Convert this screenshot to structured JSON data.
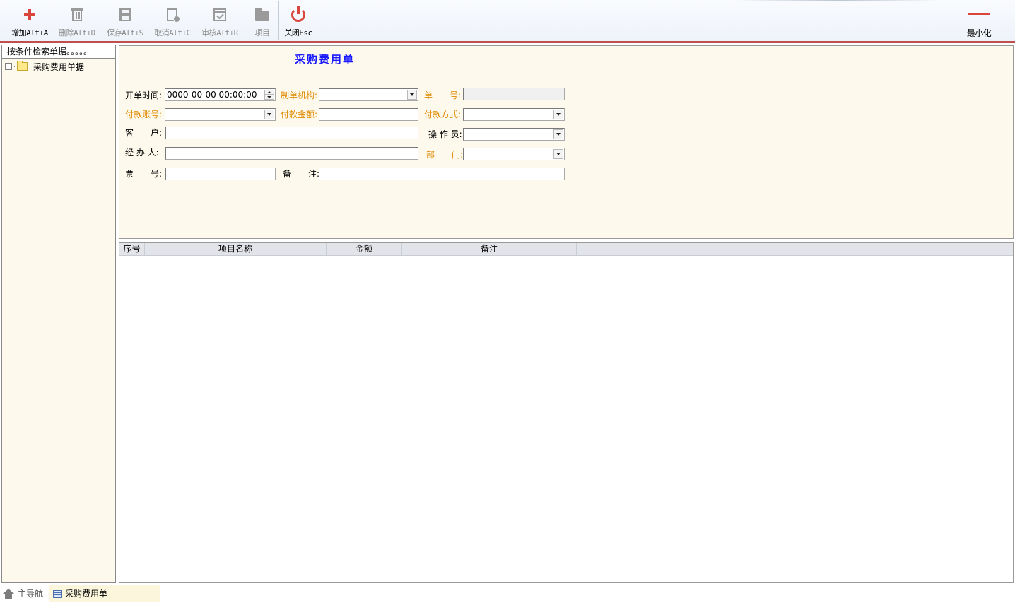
{
  "toolbar": {
    "buttons": [
      {
        "label": "增加Alt+A",
        "icon": "plus-icon",
        "enabled": true
      },
      {
        "label": "删除Alt+D",
        "icon": "trash-icon",
        "enabled": false
      },
      {
        "label": "保存Alt+S",
        "icon": "save-icon",
        "enabled": false
      },
      {
        "label": "取消Alt+C",
        "icon": "cancel-icon",
        "enabled": false
      },
      {
        "label": "审核Alt+R",
        "icon": "audit-icon",
        "enabled": false
      },
      {
        "label": "项目",
        "icon": "folder-icon",
        "enabled": false
      },
      {
        "label": "关闭Esc",
        "icon": "power-icon",
        "enabled": true
      }
    ],
    "minimize_label": "最小化"
  },
  "left_panel": {
    "search_label": "按条件检索单据。。。。。",
    "tree": [
      {
        "label": "采购费用单据"
      }
    ]
  },
  "form": {
    "title": "采购费用单",
    "fields": {
      "open_time": {
        "label": "开单时间:",
        "value": "0000-00-00 00:00:00"
      },
      "org": {
        "label": "制单机构:",
        "value": ""
      },
      "doc_no": {
        "label": "单　　号:",
        "value": ""
      },
      "pay_account": {
        "label": "付款账号:",
        "value": ""
      },
      "pay_amount": {
        "label": "付款金额:",
        "value": ""
      },
      "pay_method": {
        "label": "付款方式:",
        "value": ""
      },
      "customer": {
        "label": "客　　户:",
        "value": ""
      },
      "operator": {
        "label": "操 作 员:",
        "value": ""
      },
      "handler": {
        "label": "经 办 人:",
        "value": ""
      },
      "department": {
        "label": "部　　门:",
        "value": ""
      },
      "ticket_no": {
        "label": "票　　号:",
        "value": ""
      },
      "remark": {
        "label": "备　　注:",
        "value": ""
      }
    }
  },
  "grid": {
    "columns": [
      "序号",
      "项目名称",
      "金额",
      "备注"
    ],
    "rows": []
  },
  "bottom_tabs": [
    {
      "label": "主导航",
      "icon": "home-icon"
    },
    {
      "label": "采购费用单",
      "icon": "form-icon"
    }
  ],
  "colors": {
    "accent_red": "#d9463e",
    "title_blue": "#1a1aff",
    "label_orange": "#e08a00",
    "panel_bg": "#fdf9ed"
  }
}
